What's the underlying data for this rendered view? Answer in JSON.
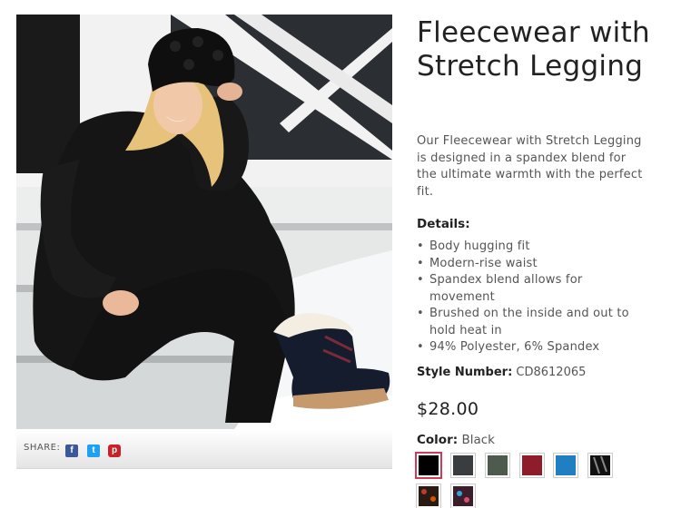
{
  "product": {
    "title": "Fleecewear with Stretch Legging",
    "description": "Our Fleecewear with Stretch Legging is designed in a spandex blend for the ultimate warmth with the perfect fit.",
    "details_heading": "Details:",
    "details": [
      "Body hugging fit",
      "Modern-rise waist",
      "Spandex blend allows for movement",
      "Brushed on the inside and out to hold heat in",
      "94% Polyester, 6% Spandex"
    ],
    "style_label": "Style Number:",
    "style_number": "CD8612065",
    "price": "$28.00",
    "color_label": "Color:",
    "color_value": "Black"
  },
  "share": {
    "label": "SHARE:",
    "icons": [
      "facebook-icon",
      "twitter-icon",
      "pinterest-icon"
    ]
  },
  "swatches": [
    {
      "name": "black",
      "color": "#000000",
      "selected": true
    },
    {
      "name": "charcoal",
      "color": "#3a3d40"
    },
    {
      "name": "olive-gray",
      "color": "#4f5a4f"
    },
    {
      "name": "burgundy",
      "color": "#8e1c2a"
    },
    {
      "name": "blue",
      "color": "#1f7fc0"
    },
    {
      "name": "black-print",
      "color": "#111111"
    },
    {
      "name": "pattern-1",
      "color": "#2a1a14"
    },
    {
      "name": "pattern-2",
      "color": "#3a1e2c"
    }
  ]
}
